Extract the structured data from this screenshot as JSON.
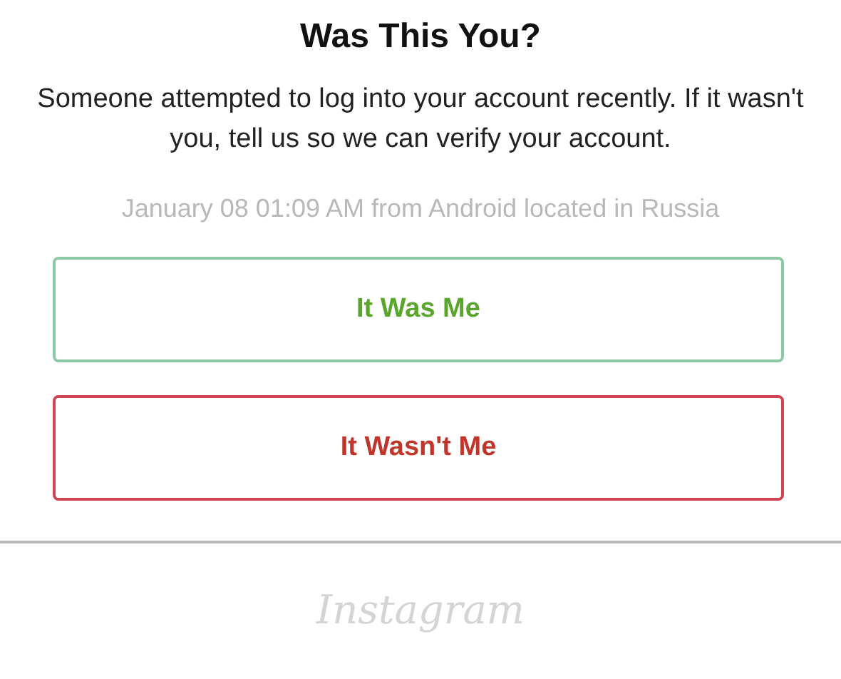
{
  "title": "Was This You?",
  "message": "Someone attempted to log into your account recently. If it wasn't you, tell us so we can verify your account.",
  "login_details": "January 08 01:09 AM from Android located in Russia",
  "buttons": [
    {
      "label": "It Was Me",
      "kind": "confirm"
    },
    {
      "label": "It Wasn't Me",
      "kind": "deny"
    }
  ],
  "footer_logo": "Instagram"
}
